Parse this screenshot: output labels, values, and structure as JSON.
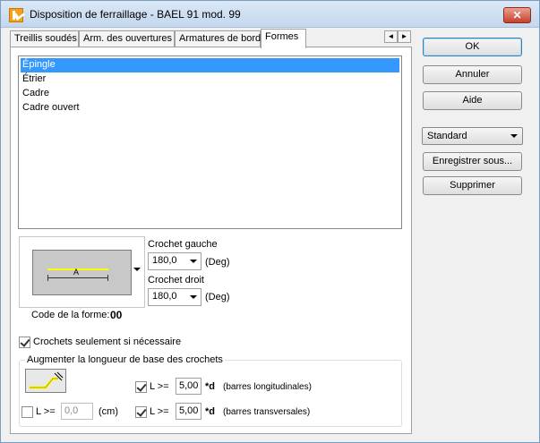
{
  "window": {
    "title": "Disposition de ferraillage - BAEL 91 mod. 99",
    "close_glyph": "✕"
  },
  "tabs": [
    {
      "label": "Treillis soudés"
    },
    {
      "label": "Arm. des ouvertures"
    },
    {
      "label": "Armatures de bord"
    },
    {
      "label": "Formes"
    }
  ],
  "tab_scroll": {
    "left": "◄",
    "right": "►"
  },
  "shapes_list": {
    "items": [
      "Épingle",
      "Étrier",
      "Cadre",
      "Cadre ouvert"
    ],
    "selected": "Épingle"
  },
  "preview": {
    "dim_label": "A"
  },
  "hooks": {
    "left_label": "Crochet gauche",
    "left_value": "180,0",
    "right_label": "Crochet droit",
    "right_value": "180,0",
    "unit": "(Deg)"
  },
  "shape_code": {
    "label": "Code de la forme:",
    "value": "00"
  },
  "only_if_needed": {
    "label": "Crochets seulement si nécessaire",
    "checked": true
  },
  "increase_group": {
    "title": "Augmenter la longueur de base des crochets",
    "longitudinal": {
      "checked": true,
      "prefix": "L >=",
      "value": "5,00",
      "suffix": "*d",
      "note": "(barres longitudinales)"
    },
    "transversal": {
      "checked": true,
      "prefix": "L >=",
      "value": "5,00",
      "suffix": "*d",
      "note": "(barres transversales)"
    },
    "absolute": {
      "checked": false,
      "prefix": "L >=",
      "value": "0,0",
      "unit": "(cm)"
    }
  },
  "buttons": {
    "ok": "OK",
    "cancel": "Annuler",
    "help": "Aide",
    "save_as": "Enregistrer sous...",
    "delete": "Supprimer"
  },
  "preset": {
    "value": "Standard"
  },
  "colors": {
    "selection": "#3399ff",
    "rebar": "#ffff00",
    "panel": "#c8c8c8"
  }
}
